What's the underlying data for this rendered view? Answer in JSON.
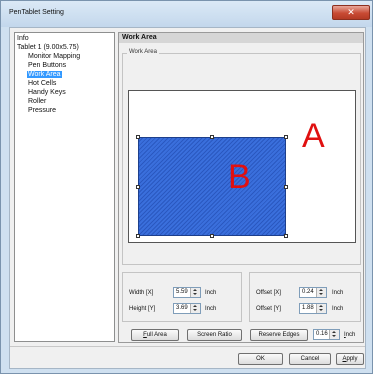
{
  "window": {
    "title": "PenTablet Setting",
    "close_glyph": "✕"
  },
  "tree": {
    "items": [
      {
        "label": "Info",
        "level": "root",
        "selected": false
      },
      {
        "label": "Tablet 1 (9.00x5.75)",
        "level": "root",
        "selected": false
      },
      {
        "label": "Monitor Mapping",
        "level": "child",
        "selected": false
      },
      {
        "label": "Pen Buttons",
        "level": "child",
        "selected": false
      },
      {
        "label": "Work Area",
        "level": "child",
        "selected": true
      },
      {
        "label": "Hot Cells",
        "level": "child",
        "selected": false
      },
      {
        "label": "Handy Keys",
        "level": "child",
        "selected": false
      },
      {
        "label": "Roller",
        "level": "child",
        "selected": false
      },
      {
        "label": "Pressure",
        "level": "child",
        "selected": false
      }
    ]
  },
  "panel": {
    "header": "Work Area",
    "group_label": "Work Area",
    "label_outer": "A",
    "label_inner": "B"
  },
  "size": {
    "width_label": "Width [X]",
    "width_value": "5.59",
    "height_label": "Height [Y]",
    "height_value": "3.69",
    "unit": "Inch"
  },
  "offset": {
    "x_label": "Offset [X]",
    "x_value": "0.24",
    "y_label": "Offset [Y]",
    "y_value": "1.88",
    "unit": "Inch"
  },
  "buttons": {
    "full_area_first": "F",
    "full_area_rest": "ull Area",
    "screen_ratio": "Screen Ratio",
    "reserve_edges": "Reserve Edges",
    "reserve_value": "0.16",
    "reserve_unit_first": "I",
    "reserve_unit_rest": "nch"
  },
  "dialog": {
    "ok": "OK",
    "cancel": "Cancel",
    "apply_first": "A",
    "apply_rest": "pply"
  }
}
